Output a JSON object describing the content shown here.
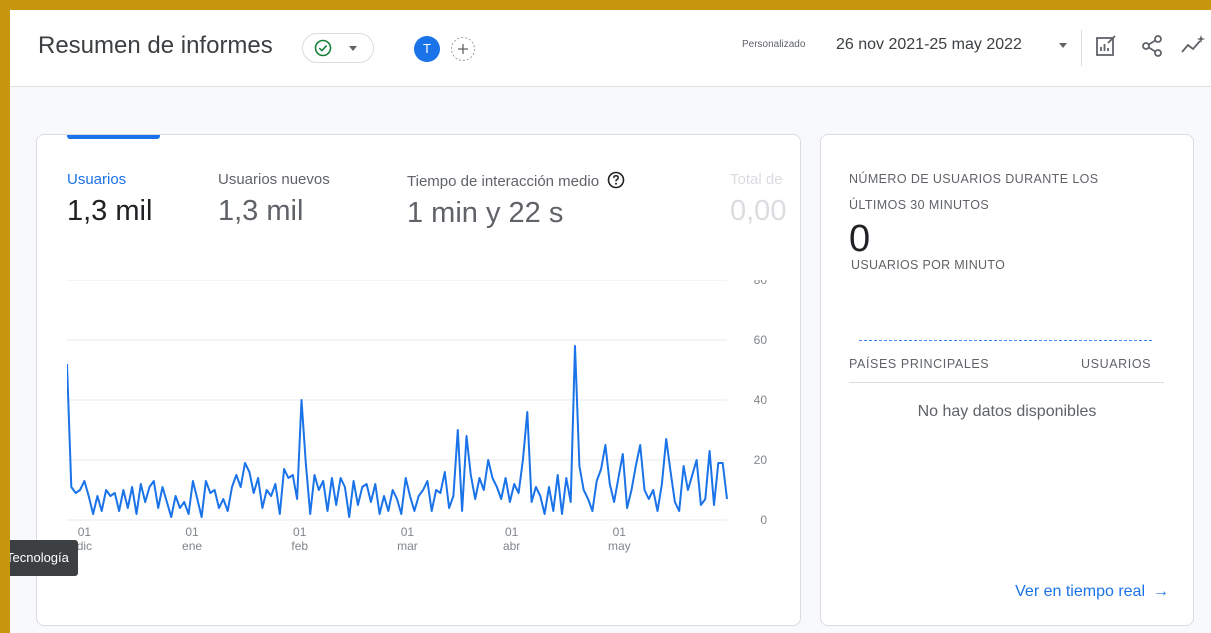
{
  "header": {
    "title": "Resumen de informes",
    "avatar_initial": "T",
    "date_caption": "Personalizado",
    "date_range": "26 nov 2021-25 may 2022",
    "icons": [
      "check-circle-icon",
      "chevron-down-icon",
      "add-comparison-icon",
      "customize-report-icon",
      "share-icon",
      "insights-icon"
    ]
  },
  "metrics": [
    {
      "label": "Usuarios",
      "value": "1,3 mil"
    },
    {
      "label": "Usuarios nuevos",
      "value": "1,3 mil"
    },
    {
      "label": "Tiempo de interacción medio",
      "value": "1 min y 22 s"
    },
    {
      "label": "Total de",
      "value": "0,00"
    }
  ],
  "tooltip": {
    "text": "Tecnología"
  },
  "chart_data": {
    "type": "line",
    "series": [
      {
        "values": [
          52,
          11,
          9,
          10,
          13,
          8,
          2,
          8,
          3,
          10,
          8,
          9,
          3,
          10,
          4,
          11,
          2,
          12,
          6,
          11,
          13,
          4,
          11,
          6,
          1,
          8,
          4,
          6,
          2,
          13,
          7,
          1,
          13,
          9,
          10,
          4,
          7,
          3,
          11,
          15,
          11,
          19,
          16,
          9,
          14,
          4,
          10,
          8,
          12,
          2,
          17,
          14,
          15,
          7,
          40,
          19,
          2,
          15,
          10,
          13,
          3,
          14,
          5,
          14,
          11,
          1,
          13,
          5,
          11,
          12,
          6,
          12,
          2,
          8,
          3,
          10,
          7,
          2,
          14,
          8,
          3,
          8,
          10,
          13,
          3,
          10,
          9,
          16,
          4,
          8,
          30,
          3,
          28,
          15,
          7,
          14,
          10,
          20,
          14,
          11,
          7,
          14,
          6,
          12,
          9,
          20,
          36,
          6,
          11,
          8,
          2,
          11,
          3,
          15,
          2,
          14,
          6,
          58,
          18,
          10,
          7,
          3,
          13,
          17,
          25,
          12,
          6,
          14,
          22,
          4,
          10,
          18,
          25,
          10,
          7,
          10,
          3,
          12,
          27,
          16,
          6,
          3,
          18,
          10,
          15,
          20,
          5,
          7,
          23,
          5,
          19,
          19,
          7
        ]
      }
    ],
    "x_ticks": [
      {
        "day": "01",
        "month": "dic"
      },
      {
        "day": "01",
        "month": "ene"
      },
      {
        "day": "01",
        "month": "feb"
      },
      {
        "day": "01",
        "month": "mar"
      },
      {
        "day": "01",
        "month": "abr"
      },
      {
        "day": "01",
        "month": "may"
      }
    ],
    "y_ticks": [
      0,
      20,
      40,
      60,
      80
    ],
    "ylim": [
      0,
      80
    ],
    "line_color": "#1a73e8",
    "grid": true
  },
  "realtime": {
    "title": "NÚMERO DE USUARIOS DURANTE LOS ÚLTIMOS 30 MINUTOS",
    "value": "0",
    "sub": "USUARIOS POR MINUTO",
    "col_left": "PAÍSES PRINCIPALES",
    "col_right": "USUARIOS",
    "empty": "No hay datos disponibles",
    "link": "Ver en tiempo real"
  },
  "colors": {
    "accent": "#1a73e8",
    "frame": "#c8960c"
  }
}
